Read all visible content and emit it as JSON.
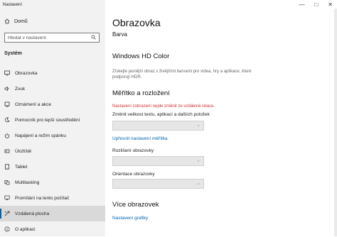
{
  "window": {
    "title": "Nastavení",
    "controls": [
      "—",
      "□",
      "✕"
    ]
  },
  "sidebar": {
    "home_label": "Domů",
    "search_placeholder": "Hledat v nastavení",
    "section_title": "Systém",
    "items": [
      {
        "label": "Obrazovka",
        "icon": "display-icon"
      },
      {
        "label": "Zvuk",
        "icon": "speaker-icon"
      },
      {
        "label": "Oznámení a akce",
        "icon": "notification-icon"
      },
      {
        "label": "Pomocník pro lepší soustředění",
        "icon": "moon-icon"
      },
      {
        "label": "Napájení a režim spánku",
        "icon": "power-icon"
      },
      {
        "label": "Úložiště",
        "icon": "storage-icon"
      },
      {
        "label": "Tablet",
        "icon": "tablet-icon"
      },
      {
        "label": "Multitasking",
        "icon": "multitasking-icon"
      },
      {
        "label": "Promítání na tento počítač",
        "icon": "projection-icon"
      },
      {
        "label": "Vzdálená plocha",
        "icon": "remote-desktop-icon"
      },
      {
        "label": "O aplikaci",
        "icon": "info-icon"
      }
    ],
    "active_index": 9
  },
  "main": {
    "title": "Obrazovka",
    "subtitle": "Barva",
    "hd_color": {
      "heading": "Windows HD Color",
      "description": "Získejte jasnější obraz s živějšími barvami pro videa, hry a aplikace, které podporují HDR."
    },
    "scale": {
      "heading": "Měřítko a rozložení",
      "warning": "Nastavení zobrazení nejde změnit ze vzdálené relace.",
      "size_label": "Změnit velikost textu, aplikací a dalších položek",
      "advanced_link": "Upřesnit nastavení měřítka",
      "resolution_label": "Rozlišení obrazovky",
      "orientation_label": "Orientace obrazovky"
    },
    "multi": {
      "heading": "Více obrazovek",
      "graphics_link": "Nastavení grafiky"
    }
  },
  "colors": {
    "accent": "#0063b1",
    "warning": "#d13438"
  }
}
